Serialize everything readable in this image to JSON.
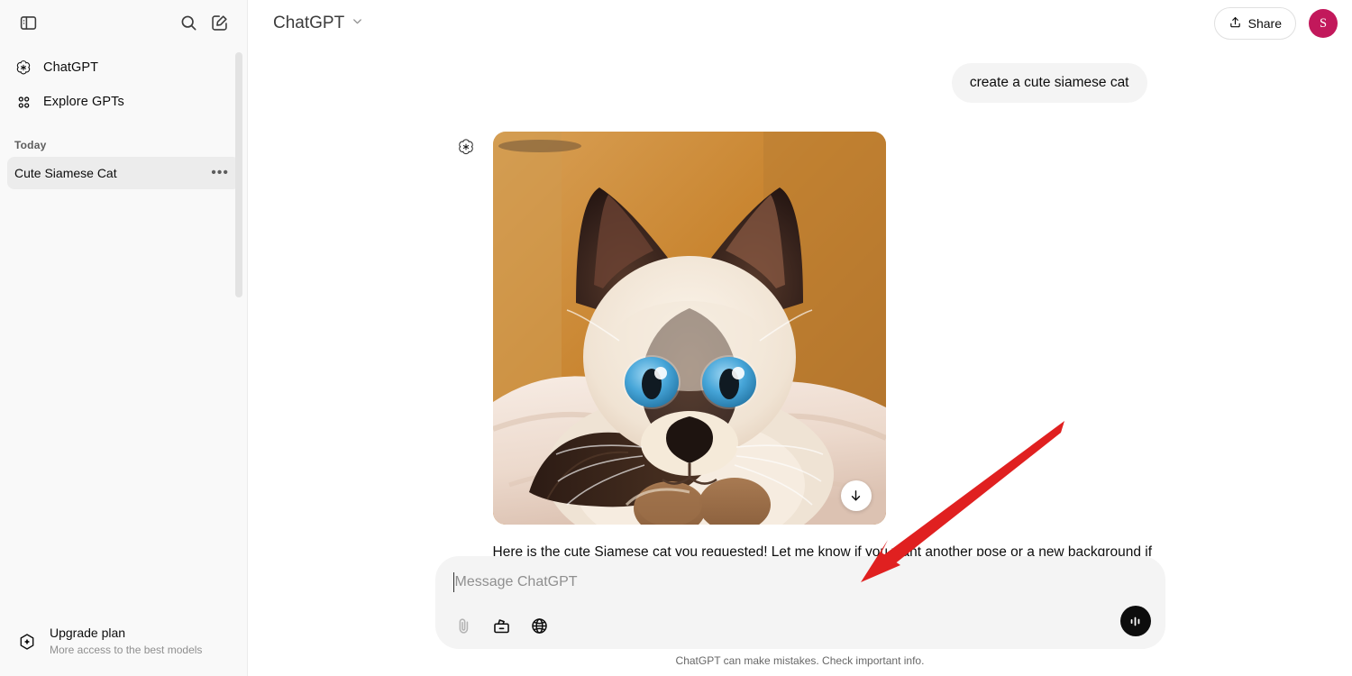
{
  "sidebar": {
    "toggle_icon": "sidebar-panel-icon",
    "search_icon": "search-icon",
    "new_chat_icon": "new-chat-pencil-icon",
    "nav": [
      {
        "label": "ChatGPT",
        "icon": "openai-logo-icon"
      },
      {
        "label": "Explore GPTs",
        "icon": "grid-dots-icon"
      }
    ],
    "section_title": "Today",
    "chats": [
      {
        "title": "Cute Siamese Cat",
        "active": true,
        "menu": "•••"
      }
    ],
    "upgrade": {
      "title": "Upgrade plan",
      "subtitle": "More access to the best models",
      "icon": "upgrade-hexagon-icon"
    }
  },
  "topbar": {
    "model_name": "ChatGPT",
    "model_chevron": "chevron-down-icon",
    "share_label": "Share",
    "share_icon": "share-upload-icon",
    "avatar_initial": "S",
    "avatar_color": "#c2185b"
  },
  "conversation": {
    "user_message": "create a cute siamese cat",
    "assistant_avatar": "openai-logo-icon",
    "generated_image": {
      "alt": "A cute Siamese cat with blue eyes resting on a cream pillow",
      "download_icon": "download-arrow-icon",
      "colors": {
        "background": "#c98b3d",
        "pillow": "#efe1d8",
        "fur_light": "#f2e9e0",
        "points_dark": "#3a2418",
        "eye_blue": "#3f9fd4"
      }
    },
    "assistant_text": "Here is the cute Siamese cat you requested! Let me know if you want another pose or a new background if you like."
  },
  "composer": {
    "placeholder": "Message ChatGPT",
    "value": "",
    "tools": [
      {
        "name": "attach-file-icon",
        "label": "Attach file"
      },
      {
        "name": "tools-toolbox-icon",
        "label": "Tools"
      },
      {
        "name": "globe-web-search-icon",
        "label": "Search the web"
      }
    ],
    "voice_button_icon": "voice-waveform-icon"
  },
  "footer": {
    "disclaimer": "ChatGPT can make mistakes. Check important info."
  },
  "annotation": {
    "arrow_color": "#e02020",
    "points_to": "composer"
  }
}
